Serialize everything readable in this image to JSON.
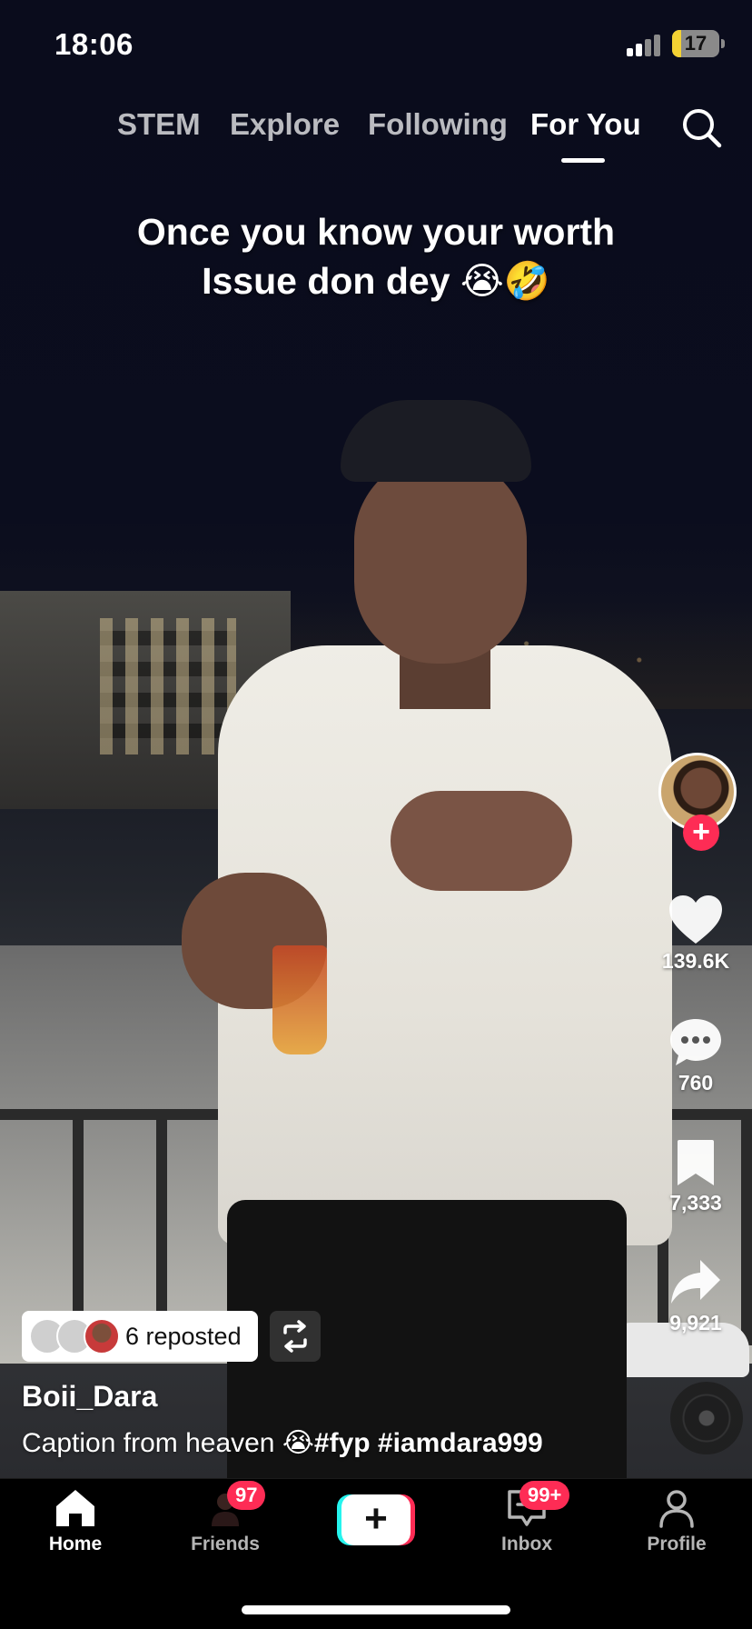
{
  "status_bar": {
    "time": "18:06",
    "battery": "17",
    "battery_color": "#f4d233"
  },
  "top_tabs": [
    {
      "label": "STEM",
      "active": false
    },
    {
      "label": "Explore",
      "active": false
    },
    {
      "label": "Following",
      "active": false
    },
    {
      "label": "For You",
      "active": true
    }
  ],
  "overlay_text": {
    "line1": "Once you know your worth",
    "line2": "Issue don dey 😭🤣"
  },
  "actions": {
    "likes": "139.6K",
    "comments": "760",
    "bookmarks": "7,333",
    "shares": "9,921"
  },
  "repost": {
    "label": "6 reposted"
  },
  "post": {
    "username": "Boii_Dara",
    "caption_text": "Caption from heaven 😭",
    "caption_tags": "#fyp #iamdara999"
  },
  "bottom_nav": {
    "home": "Home",
    "friends": "Friends",
    "friends_badge": "97",
    "inbox": "Inbox",
    "inbox_badge": "99+",
    "profile": "Profile"
  },
  "colors": {
    "accent": "#fe2c55",
    "cyan": "#25f4ee"
  }
}
